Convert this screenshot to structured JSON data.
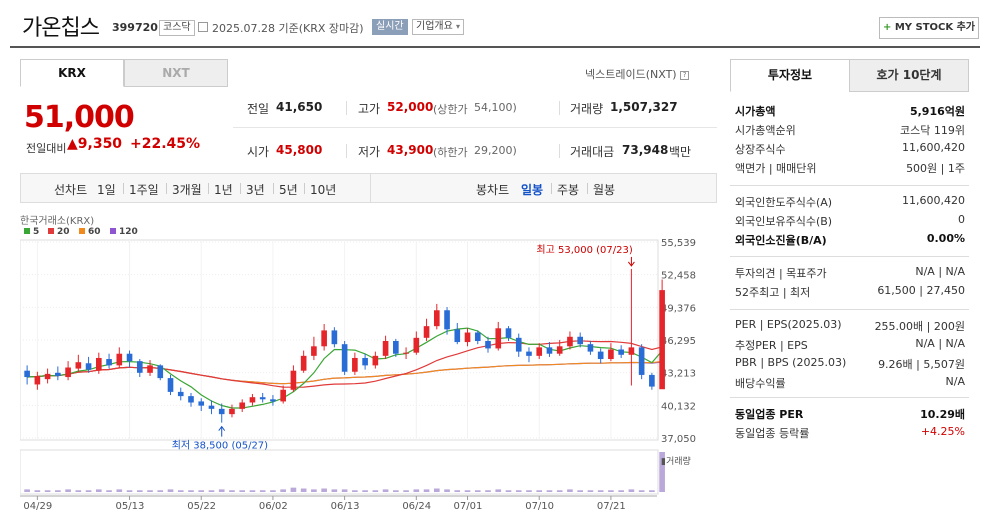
{
  "header": {
    "name": "가온칩스",
    "code": "399720",
    "market_tag": "코스닥",
    "date_text": "2025.07.28  기준(KRX 장마감)",
    "realtime_tag": "실시간",
    "overview_btn": "기업개요",
    "mystock_btn": "MY STOCK 추가"
  },
  "tabs": {
    "krx": "KRX",
    "nxt": "NXT",
    "nxt_link": "넥스트레이드(NXT)"
  },
  "price": {
    "current": "51,000",
    "prev_label": "전일대비",
    "change": "▲9,350",
    "change_pct": "+22.45%"
  },
  "quote": {
    "prev_label": "전일",
    "prev_val": "41,650",
    "high_label": "고가",
    "high_val": "52,000",
    "upper_label": "(상한가",
    "upper_val": "54,100)",
    "volume_label": "거래량",
    "volume_val": "1,507,327",
    "open_label": "시가",
    "open_val": "45,800",
    "low_label": "저가",
    "low_val": "43,900",
    "lower_label": "(하한가",
    "lower_val": "29,200)",
    "amount_label": "거래대금",
    "amount_val": "73,948",
    "amount_unit": "백만"
  },
  "period_bar": {
    "line_label": "선차트",
    "line_items": [
      "1일",
      "1주일",
      "3개월",
      "1년",
      "3년",
      "5년",
      "10년"
    ],
    "candle_label": "봉차트",
    "candle_items": [
      "일봉",
      "주봉",
      "월봉"
    ],
    "candle_selected": "일봉"
  },
  "right_panel": {
    "tab_invest": "투자정보",
    "tab_hoga": "호가 10단계",
    "rows_1": [
      {
        "label": "시가총액",
        "value": "5,916억원",
        "bold": true
      },
      {
        "label": "시가총액순위",
        "value": "코스닥 119위"
      },
      {
        "label": "상장주식수",
        "value": "11,600,420"
      },
      {
        "label": "액면가 | 매매단위",
        "value": "500원 | 1주"
      }
    ],
    "rows_2": [
      {
        "label": "외국인한도주식수(A)",
        "value": "11,600,420"
      },
      {
        "label": "외국인보유주식수(B)",
        "value": "0"
      },
      {
        "label": "외국인소진율(B/A)",
        "value": "0.00%",
        "bold": true
      }
    ],
    "rows_3": [
      {
        "label": "투자의견 | 목표주가",
        "value": "N/A | N/A"
      },
      {
        "label": "52주최고 | 최저",
        "value": "61,500 | 27,450"
      }
    ],
    "rows_4": [
      {
        "label": "PER | EPS(2025.03)",
        "value": "255.00배 | 200원"
      },
      {
        "label": "추정PER | EPS",
        "value": "N/A | N/A"
      },
      {
        "label": "PBR | BPS (2025.03)",
        "value": "9.26배 | 5,507원"
      },
      {
        "label": "배당수익률",
        "value": "N/A"
      }
    ],
    "rows_5": [
      {
        "label": "동일업종 PER",
        "value": "10.29배",
        "bold": true
      },
      {
        "label": "동일업종 등락률",
        "value": "+4.25%",
        "red": true
      }
    ]
  },
  "colors": {
    "up": "#e4262b",
    "down": "#2a6cd6",
    "ma5": "#3aa635",
    "ma20": "#e03a3a",
    "ma60": "#f08a1e",
    "ma120": "#8f55d0"
  },
  "chart_data": {
    "type": "candlestick",
    "exchange_label": "한국거래소(KRX)",
    "legend": [
      {
        "name": "5"
      },
      {
        "name": "20"
      },
      {
        "name": "60"
      },
      {
        "name": "120"
      }
    ],
    "y_ticks": [
      55539,
      52458,
      49376,
      46295,
      43213,
      40132,
      37050
    ],
    "y_tick_labels": [
      "55,539",
      "52,458",
      "49,376",
      "46,295",
      "43,213",
      "40,132",
      "37,050"
    ],
    "ylim": [
      37050,
      55539
    ],
    "x_tick_labels": [
      "04/29",
      "05/13",
      "05/22",
      "06/02",
      "06/13",
      "06/24",
      "07/01",
      "07/10",
      "07/21"
    ],
    "x_tick_index": [
      1,
      10,
      17,
      24,
      31,
      38,
      43,
      50,
      57
    ],
    "n_bars": 62,
    "annotation_high": "최고 53,000 (07/23)",
    "annotation_low": "최저 38,500 (05/27)",
    "high_index": 59,
    "low_index": 19,
    "volume_label": "거래량",
    "candles": [
      [
        43400,
        42800,
        43900,
        42100
      ],
      [
        42100,
        42900,
        43300,
        41600
      ],
      [
        42600,
        43100,
        43600,
        42200
      ],
      [
        43200,
        42900,
        43800,
        42500
      ],
      [
        42800,
        43700,
        44300,
        42500
      ],
      [
        43600,
        44200,
        44900,
        43300
      ],
      [
        44100,
        43500,
        44700,
        43200
      ],
      [
        43400,
        44600,
        45100,
        43100
      ],
      [
        44500,
        43900,
        45000,
        43600
      ],
      [
        43900,
        45000,
        45600,
        43600
      ],
      [
        45000,
        44300,
        45300,
        43700
      ],
      [
        44300,
        43200,
        44500,
        42800
      ],
      [
        43200,
        43900,
        44400,
        42900
      ],
      [
        43900,
        42700,
        44000,
        42500
      ],
      [
        42700,
        41400,
        43000,
        41100
      ],
      [
        41400,
        41000,
        41800,
        40600
      ],
      [
        41000,
        40400,
        41300,
        40000
      ],
      [
        40500,
        40100,
        40800,
        39600
      ],
      [
        40100,
        39800,
        40600,
        39300
      ],
      [
        39800,
        39300,
        40300,
        38500
      ],
      [
        39300,
        39800,
        40200,
        39000
      ],
      [
        39800,
        40400,
        40700,
        39500
      ],
      [
        40400,
        40900,
        41200,
        40100
      ],
      [
        40900,
        40700,
        41300,
        40400
      ],
      [
        40700,
        40500,
        41100,
        40100
      ],
      [
        40500,
        41600,
        42000,
        40300
      ],
      [
        41600,
        43400,
        43900,
        41400
      ],
      [
        43400,
        44800,
        45300,
        43200
      ],
      [
        44800,
        45700,
        46600,
        44400
      ],
      [
        45700,
        47200,
        47800,
        45300
      ],
      [
        47200,
        45900,
        47500,
        45600
      ],
      [
        45900,
        43300,
        46200,
        43000
      ],
      [
        43300,
        44600,
        45100,
        43000
      ],
      [
        44600,
        43900,
        45000,
        43500
      ],
      [
        43900,
        44800,
        45200,
        43600
      ],
      [
        44800,
        46200,
        46700,
        44500
      ],
      [
        46200,
        45000,
        46400,
        44700
      ],
      [
        45000,
        45100,
        45600,
        44500
      ],
      [
        45100,
        46500,
        47100,
        44900
      ],
      [
        46500,
        47600,
        48300,
        46200
      ],
      [
        47600,
        49100,
        49700,
        47300
      ],
      [
        49100,
        47300,
        49400,
        46800
      ],
      [
        47300,
        46100,
        47900,
        45900
      ],
      [
        46100,
        47000,
        47400,
        45700
      ],
      [
        47000,
        46200,
        47200,
        45900
      ],
      [
        46200,
        45500,
        46600,
        45100
      ],
      [
        45500,
        47400,
        48000,
        45300
      ],
      [
        47400,
        46500,
        47600,
        46200
      ],
      [
        46500,
        45200,
        46900,
        44700
      ],
      [
        45200,
        44800,
        45600,
        44200
      ],
      [
        44800,
        45600,
        46000,
        44500
      ],
      [
        45600,
        45000,
        46100,
        44700
      ],
      [
        45000,
        45700,
        46300,
        44800
      ],
      [
        45700,
        46600,
        47100,
        45400
      ],
      [
        46600,
        45900,
        47000,
        45600
      ],
      [
        45900,
        45200,
        46200,
        44900
      ],
      [
        45200,
        44500,
        45500,
        44100
      ],
      [
        44500,
        45400,
        46000,
        44300
      ],
      [
        45400,
        44900,
        45800,
        44600
      ],
      [
        44900,
        45600,
        53000,
        42000
      ],
      [
        45600,
        43000,
        45900,
        42600
      ],
      [
        43000,
        41900,
        43200,
        41600
      ],
      [
        41650,
        51000,
        52000,
        43900
      ]
    ],
    "volumes": [
      3,
      2,
      2,
      2,
      3,
      2,
      2,
      3,
      2,
      3,
      2,
      2,
      2,
      2,
      3,
      2,
      2,
      2,
      2,
      3,
      2,
      2,
      2,
      2,
      2,
      3,
      5,
      4,
      3,
      4,
      3,
      3,
      2,
      2,
      2,
      3,
      2,
      2,
      3,
      3,
      4,
      3,
      2,
      2,
      2,
      2,
      3,
      2,
      2,
      2,
      2,
      2,
      2,
      3,
      2,
      2,
      2,
      2,
      2,
      3,
      2,
      2,
      46
    ]
  }
}
